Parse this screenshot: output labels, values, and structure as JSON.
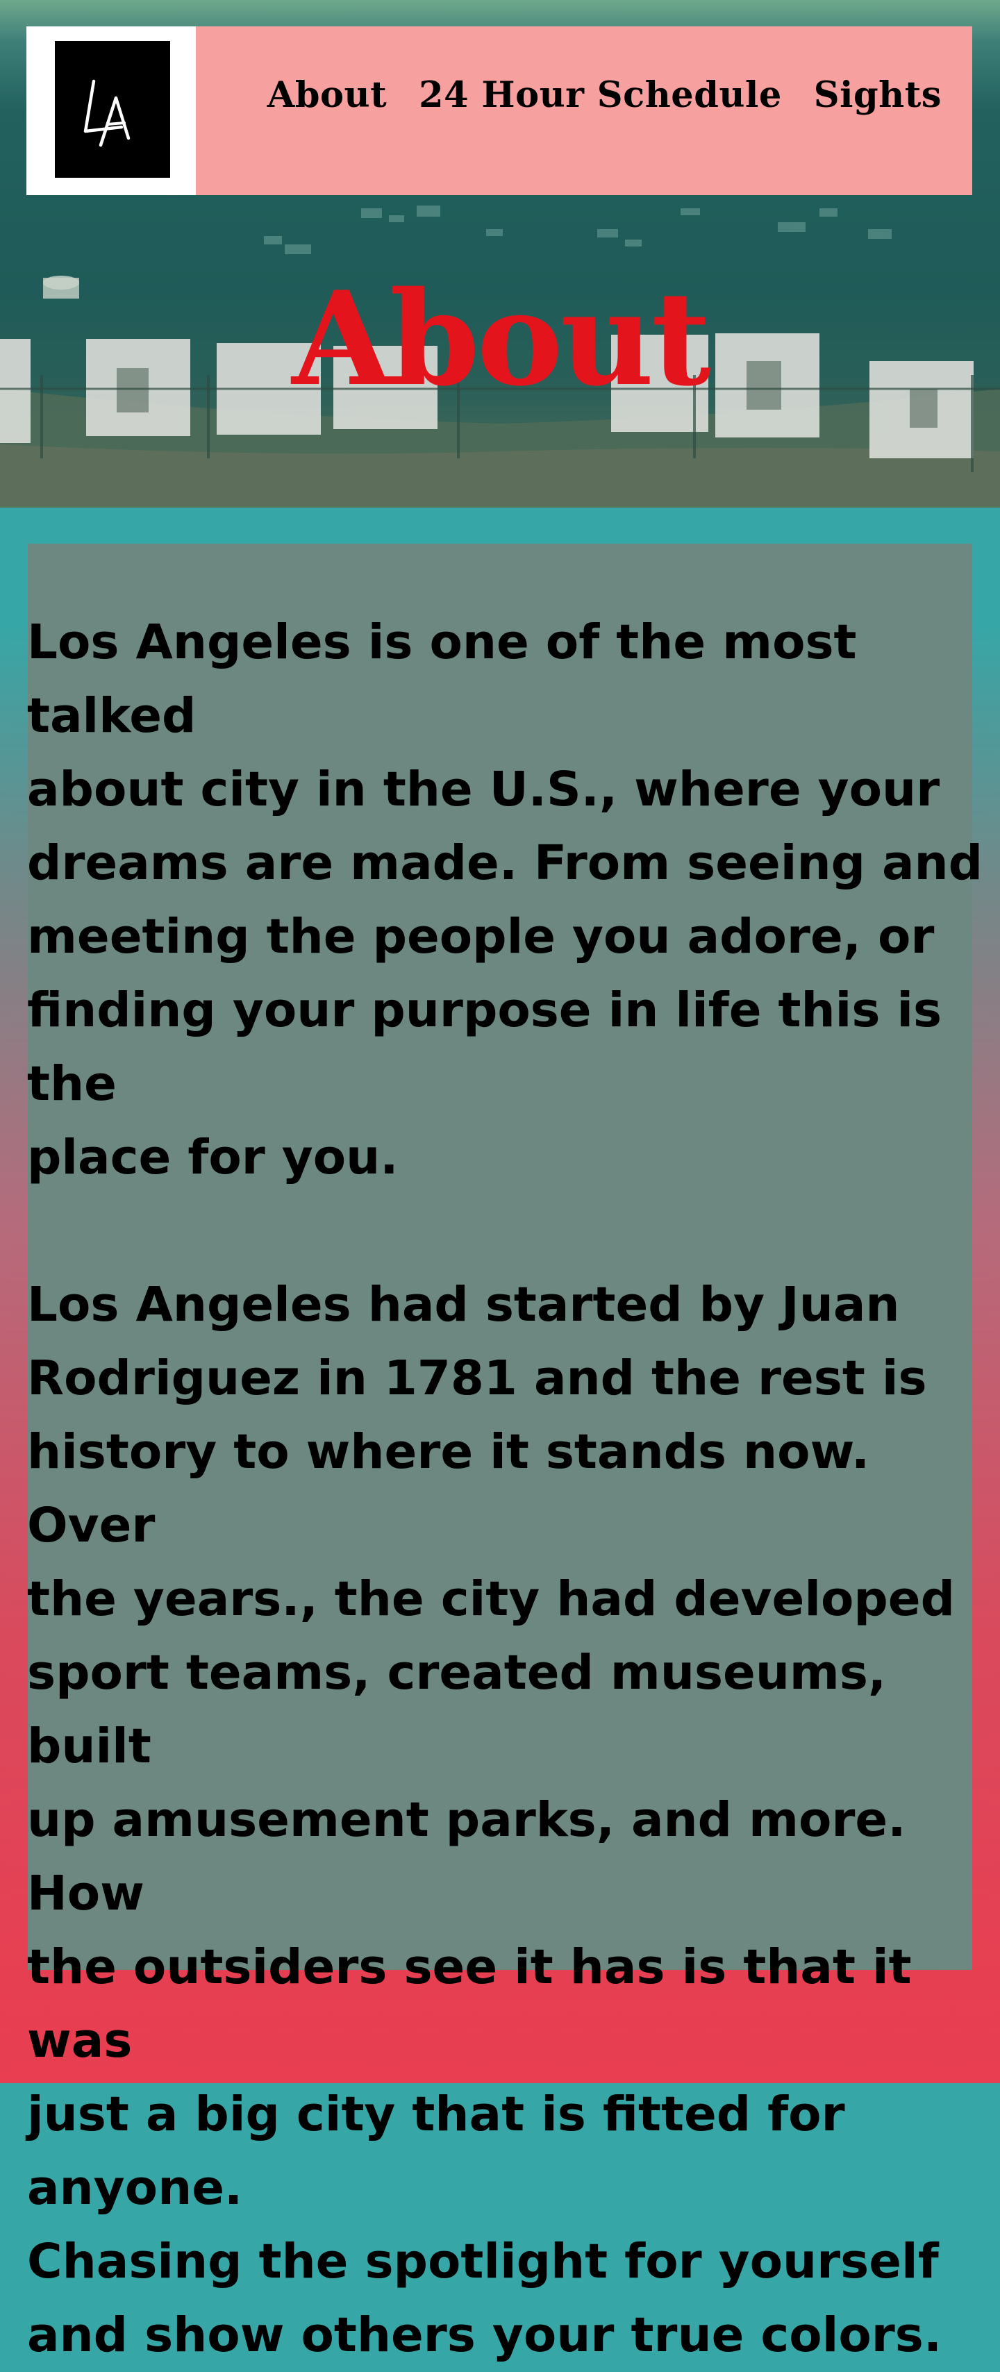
{
  "logo": {
    "text": "LA",
    "icon": "la-monogram-logo"
  },
  "nav": {
    "links": [
      {
        "label": "About"
      },
      {
        "label": "24 Hour Schedule"
      },
      {
        "label": "Sights"
      }
    ]
  },
  "hero": {
    "title": "About",
    "background": "hollywood-sign-hillside-photo"
  },
  "content": {
    "paragraphs": [
      "Los Angeles is one of the most talked\nabout city in the U.S., where your\ndreams are made. From seeing and\nmeeting the people you adore, or\nfinding your purpose in life this is the\nplace for you.",
      "Los Angeles had started by Juan\nRodriguez in 1781  and the rest is\nhistory to where it stands now. Over\nthe years., the city had developed\nsport teams, created museums, built\nup amusement parks, and more. How\nthe outsiders see it has is that it was\njust a big city that is fitted for anyone.\nChasing the  spotlight for yourself\nand show others your true colors."
    ]
  },
  "colors": {
    "nav_background": "#f7a0a0",
    "title_red": "#e3141c",
    "card_background": "#6c8880",
    "page_gradient_top": "#37a6a6",
    "page_gradient_bottom": "#e93e51"
  }
}
